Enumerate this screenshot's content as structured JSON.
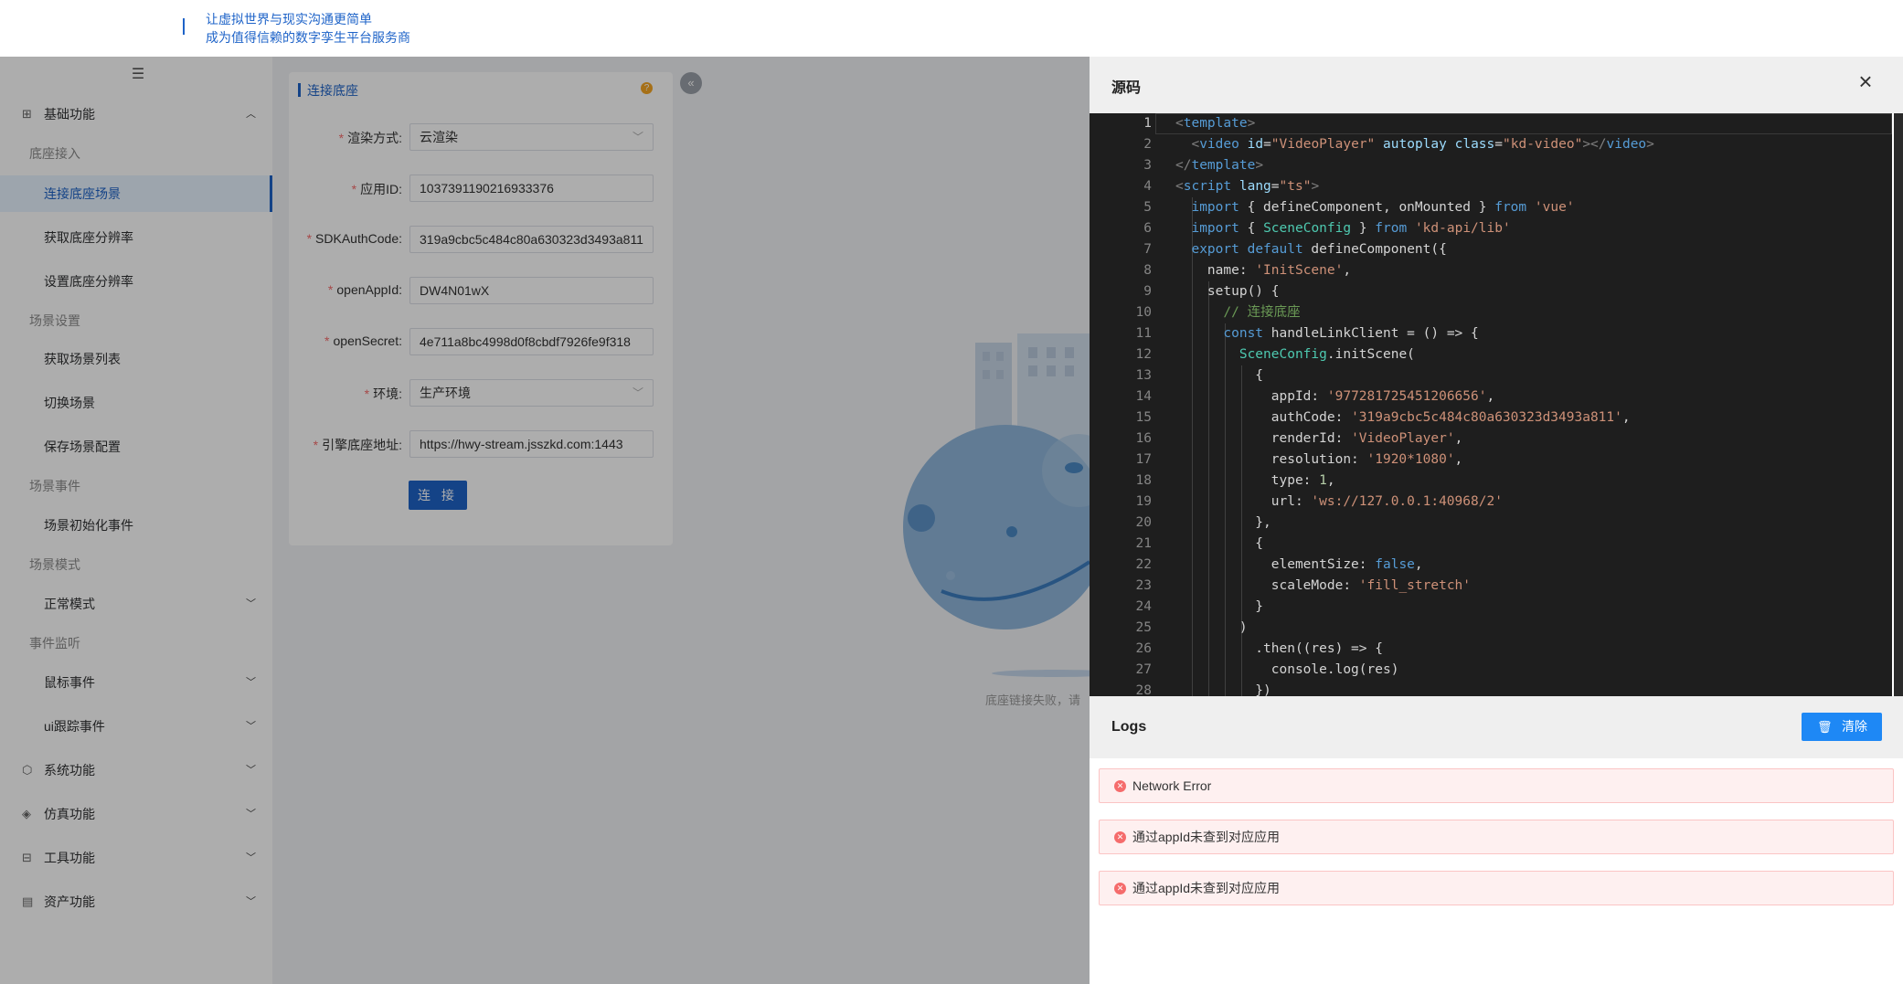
{
  "header": {
    "slogan_line1": "让虚拟世界与现实沟通更简单",
    "slogan_line2": "成为值得信赖的数字孪生平台服务商"
  },
  "sidebar": {
    "fold_icon": "menu-fold-icon",
    "sections": [
      {
        "label": "基础功能",
        "icon": "grid-icon",
        "expanded": true
      },
      {
        "label": "系统功能",
        "icon": "shield-icon"
      },
      {
        "label": "仿真功能",
        "icon": "diamond-icon"
      },
      {
        "label": "工具功能",
        "icon": "toolbox-icon"
      },
      {
        "label": "资产功能",
        "icon": "asset-icon"
      }
    ],
    "groups": [
      "底座接入",
      "场景设置",
      "场景事件",
      "场景模式",
      "事件监听"
    ],
    "items": [
      "连接底座场景",
      "获取底座分辨率",
      "设置底座分辨率",
      "获取场景列表",
      "切换场景",
      "保存场景配置",
      "场景初始化事件",
      "正常模式",
      "鼠标事件",
      "ui跟踪事件"
    ],
    "active_item": "连接底座场景"
  },
  "form": {
    "title": "连接底座",
    "fields": [
      {
        "label": "渲染方式",
        "value": "云渲染",
        "type": "select"
      },
      {
        "label": "应用ID",
        "value": "1037391190216933376"
      },
      {
        "label": "SDKAuthCode",
        "value": "319a9cbc5c484c80a630323d3493a811"
      },
      {
        "label": "openAppId",
        "value": "DW4N01wX"
      },
      {
        "label": "openSecret",
        "value": "4e711a8bc4998d0f8cbdf7926fe9f318"
      },
      {
        "label": "环境",
        "value": "生产环境",
        "type": "select"
      },
      {
        "label": "引擎底座地址",
        "value": "https://hwy-stream.jsszkd.com:1443"
      }
    ],
    "connect_label": "连 接"
  },
  "empty_state": {
    "message": "底座链接失败，请"
  },
  "source_panel": {
    "title": "源码",
    "line_numbers": [
      "1",
      "2",
      "3",
      "4",
      "5",
      "6",
      "7",
      "8",
      "9",
      "10",
      "11",
      "12",
      "13",
      "14",
      "15",
      "16",
      "17",
      "18",
      "19",
      "20",
      "21",
      "22",
      "23",
      "24",
      "25",
      "26",
      "27",
      "28"
    ]
  },
  "logs_panel": {
    "title": "Logs",
    "clear_label": "清除",
    "entries": [
      "Network Error",
      "通过appId未查到对应应用",
      "通过appId未查到对应应用"
    ]
  },
  "colors": {
    "primary": "#1e63c8",
    "button": "#1e88f5",
    "error": "#f56c6c",
    "editor_bg": "#1e1e1e"
  }
}
